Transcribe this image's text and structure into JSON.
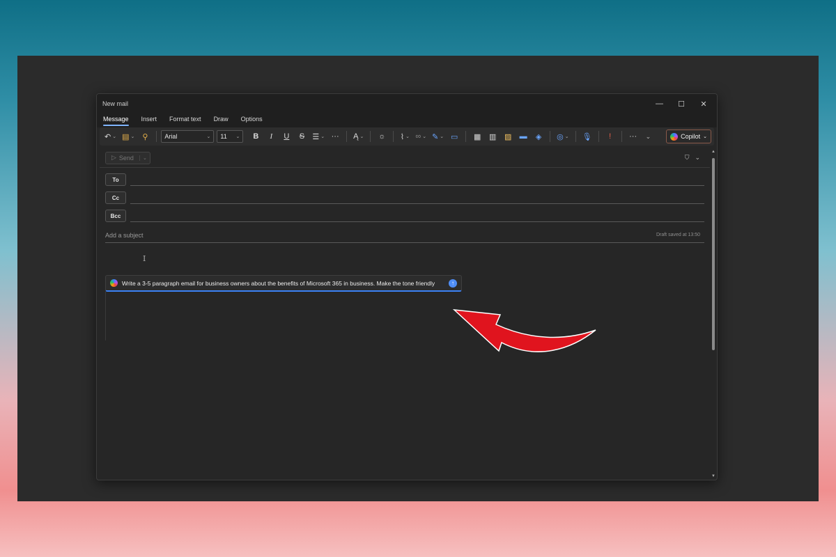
{
  "window": {
    "title": "New mail",
    "controls": {
      "minimize": "—",
      "maximize": "☐",
      "close": "✕"
    }
  },
  "tabs": [
    {
      "label": "Message",
      "active": true
    },
    {
      "label": "Insert",
      "active": false
    },
    {
      "label": "Format text",
      "active": false
    },
    {
      "label": "Draw",
      "active": false
    },
    {
      "label": "Options",
      "active": false
    }
  ],
  "ribbon": {
    "font_name": "Arial",
    "font_size": "11",
    "bold": "B",
    "italic": "I",
    "underline": "U",
    "strikethrough": "S",
    "more": "···",
    "copilot_label": "Copilot"
  },
  "compose": {
    "send_label": "Send",
    "to_label": "To",
    "cc_label": "Cc",
    "bcc_label": "Bcc",
    "subject_placeholder": "Add a subject",
    "draft_status": "Draft saved at 13:50"
  },
  "copilot_prompt": {
    "text": "Write a 3-5 paragraph email for business owners about the benefits of Microsoft 365 in business. Make the tone friendly"
  },
  "colors": {
    "accent": "#7fb4ff",
    "submit": "#4f8ef7",
    "arrow": "#e0141e"
  }
}
